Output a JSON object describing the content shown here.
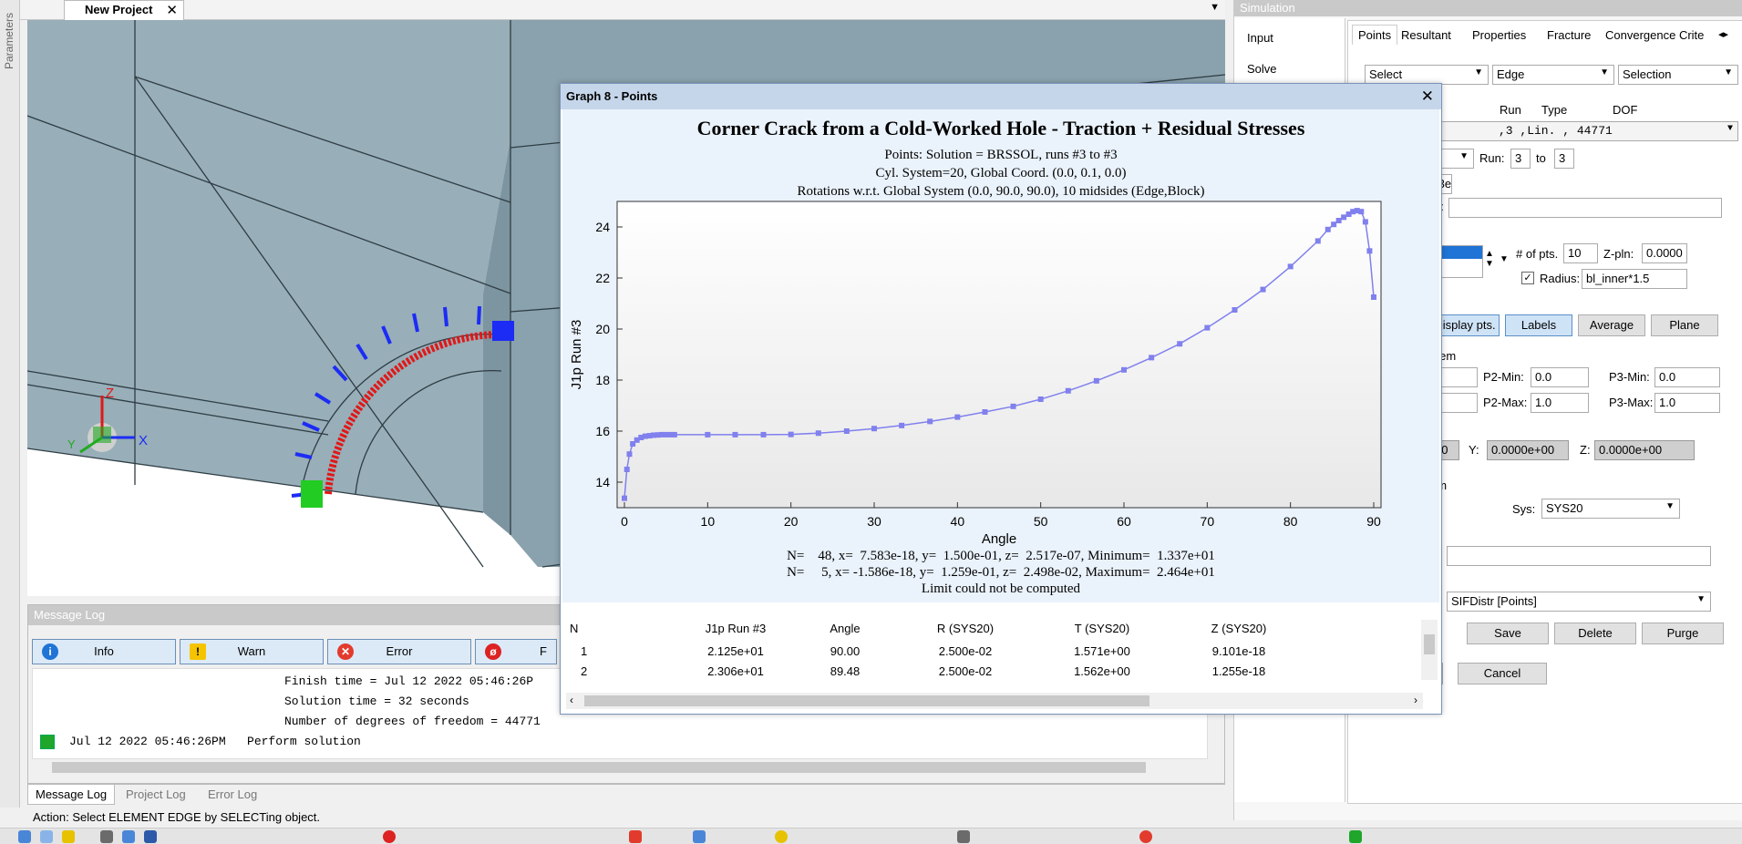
{
  "params_label": "Parameters",
  "tabs": {
    "active": "New Project"
  },
  "viewport": {
    "axis_labels": {
      "z": "Z",
      "x": "X",
      "y": "Y"
    }
  },
  "message_log": {
    "title": "Message Log",
    "filters": [
      "Info",
      "Warn",
      "Error",
      "F"
    ],
    "lines": [
      "Finish time = Jul 12 2022 05:46:26P",
      "Solution time = 32 seconds",
      "Number of degrees of freedom = 44771",
      "Jul 12 2022 05:46:26PM   Perform solution"
    ]
  },
  "bottom_tabs": [
    "Message Log",
    "Project Log",
    "Error Log"
  ],
  "status": "Action:  Select  ELEMENT EDGE  by SELECTing object.",
  "simulation": {
    "title": "Simulation",
    "nav": [
      "Input",
      "Solve"
    ],
    "tabs": [
      "Points",
      "Resultant",
      "Properties",
      "Fracture",
      "Convergence Crite"
    ],
    "row1": {
      "select": "Select",
      "edge": "Edge",
      "selection": "Selection"
    },
    "run_header": {
      "run": "Run",
      "type": "Type",
      "dof": "DOF"
    },
    "run_value": ",3  ,Lin.      , 44771",
    "run_label": "Run:",
    "run_from": "3",
    "to_label": "to",
    "run_to": "3",
    "partial_3e": ".3e",
    "partial_e": "e:",
    "npts_label": "# of pts.",
    "npts": "10",
    "zpln_label": "Z-pln:",
    "zpln": "0.0000",
    "radius_label": "Radius:",
    "radius": "bl_inner*1.5",
    "buttons": [
      "Display pts.",
      "Labels",
      "Average",
      "Plane"
    ],
    "stem_partial": "stem",
    "p2min_label": "P2-Min:",
    "p2min": "0.0",
    "p3min_label": "P3-Min:",
    "p3min": "0.0",
    "p2max_label": "P2-Max:",
    "p2max": "1.0",
    "p3max_label": "P3-Max:",
    "p3max": "1.0",
    "x_partial": "00",
    "y_label": "Y:",
    "y_val": "0.0000e+00",
    "z_label": "Z:",
    "z_val": "0.0000e+00",
    "em_partial": "em",
    "sys_label": "Sys:",
    "sys": "SYS20",
    "e_partial2": "e:",
    "e_partial3": "e:",
    "sif": "SIFDistr [Points]",
    "save": "Save",
    "delete": "Delete",
    "purge": "Purge",
    "cancel": "Cancel"
  },
  "graph": {
    "window_title": "Graph 8 - Points",
    "title": "Corner Crack from a Cold-Worked Hole - Traction + Residual Stresses",
    "subtitles": [
      "Points: Solution = BRSSOL, runs #3 to #3",
      "Cyl. System=20, Global Coord. (0.0, 0.1, 0.0)",
      "Rotations w.r.t. Global System (0.0, 90.0, 90.0), 10 midsides (Edge,Block)"
    ],
    "footer": [
      "N=    48, x=  7.583e-18, y=  1.500e-01, z=  2.517e-07, Minimum=  1.337e+01",
      "N=     5, x= -1.586e-18, y=  1.259e-01, z=  2.498e-02, Maximum=  2.464e+01",
      "Limit could not be computed"
    ],
    "table": {
      "headers": [
        "N",
        "J1p Run #3",
        "Angle",
        "R (SYS20)",
        "T (SYS20)",
        "Z (SYS20)"
      ],
      "rows": [
        [
          "1",
          "2.125e+01",
          "90.00",
          "2.500e-02",
          "1.571e+00",
          "9.101e-18"
        ],
        [
          "2",
          "2.306e+01",
          "89.48",
          "2.500e-02",
          "1.562e+00",
          "1.255e-18"
        ]
      ]
    }
  },
  "chart_data": {
    "type": "line",
    "xlabel": "Angle",
    "ylabel": "J1p Run #3",
    "xlim": [
      0,
      90
    ],
    "ylim": [
      13,
      25
    ],
    "xticks": [
      0,
      10,
      20,
      30,
      40,
      50,
      60,
      70,
      80,
      90
    ],
    "yticks": [
      14,
      16,
      18,
      20,
      22,
      24
    ],
    "grid": false,
    "color": "#8080ee",
    "series": [
      {
        "x": [
          0.0,
          0.3,
          0.6,
          1.0,
          1.5,
          2.0,
          2.5,
          3.0,
          3.5,
          4.0,
          4.5,
          5.0,
          5.5,
          6.0,
          10.0,
          13.3,
          16.7,
          20.0,
          23.3,
          26.7,
          30.0,
          33.3,
          36.7,
          40.0,
          43.3,
          46.7,
          50.0,
          53.3,
          56.7,
          60.0,
          63.3,
          66.7,
          70.0,
          73.3,
          76.7,
          80.0,
          83.3,
          84.5,
          85.2,
          85.8,
          86.4,
          87.0,
          87.5,
          88.0,
          88.5,
          89.0,
          89.5,
          90.0
        ],
        "y": [
          13.37,
          14.5,
          15.1,
          15.5,
          15.65,
          15.75,
          15.8,
          15.82,
          15.84,
          15.85,
          15.86,
          15.86,
          15.86,
          15.86,
          15.86,
          15.86,
          15.86,
          15.87,
          15.92,
          16.0,
          16.1,
          16.22,
          16.38,
          16.55,
          16.75,
          16.97,
          17.25,
          17.58,
          17.97,
          18.4,
          18.88,
          19.42,
          20.05,
          20.75,
          21.55,
          22.45,
          23.45,
          23.9,
          24.1,
          24.25,
          24.38,
          24.5,
          24.6,
          24.64,
          24.6,
          24.2,
          23.06,
          21.25
        ]
      }
    ]
  }
}
